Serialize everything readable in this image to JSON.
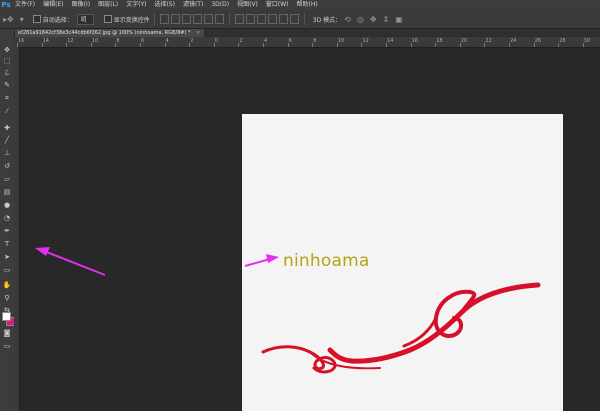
{
  "app": {
    "logo": "Ps"
  },
  "menu": [
    "文件(F)",
    "编辑(E)",
    "图像(I)",
    "图层(L)",
    "文字(Y)",
    "选择(S)",
    "滤镜(T)",
    "3D(D)",
    "视图(V)",
    "窗口(W)",
    "帮助(H)"
  ],
  "options": {
    "auto_select_label": "自动选择：",
    "auto_select_value": "组",
    "show_transform_label": "显示变换控件",
    "mode_3d_label": "3D 模式："
  },
  "document": {
    "tab_title": "ef281a91842cf38e3c44cdb6f262.jpg @ 100% (ninhoama, RGB/8#) *",
    "close_symbol": "×"
  },
  "ruler_top_labels": [
    "16",
    "14",
    "12",
    "10",
    "8",
    "6",
    "4",
    "2",
    "0",
    "2",
    "4",
    "6",
    "8",
    "10",
    "12",
    "14",
    "16",
    "18",
    "20",
    "22",
    "24",
    "26",
    "28",
    "30"
  ],
  "canvas": {
    "text": "ninhoama",
    "text_color": "#b5a313",
    "ornament_color": "#d7102a",
    "background": "#f4f4f4"
  },
  "annotation": {
    "arrow_color": "#e62ef0"
  },
  "colors": {
    "foreground": "#ffffff",
    "background": "#e0168c"
  },
  "tools": [
    "move-tool",
    "marquee-tool",
    "lasso-tool",
    "quick-select-tool",
    "crop-tool",
    "eyedropper-tool",
    "healing-tool",
    "brush-tool",
    "stamp-tool",
    "history-brush-tool",
    "eraser-tool",
    "gradient-tool",
    "blur-tool",
    "dodge-tool",
    "pen-tool",
    "type-tool",
    "path-select-tool",
    "shape-tool",
    "hand-tool",
    "zoom-tool"
  ]
}
